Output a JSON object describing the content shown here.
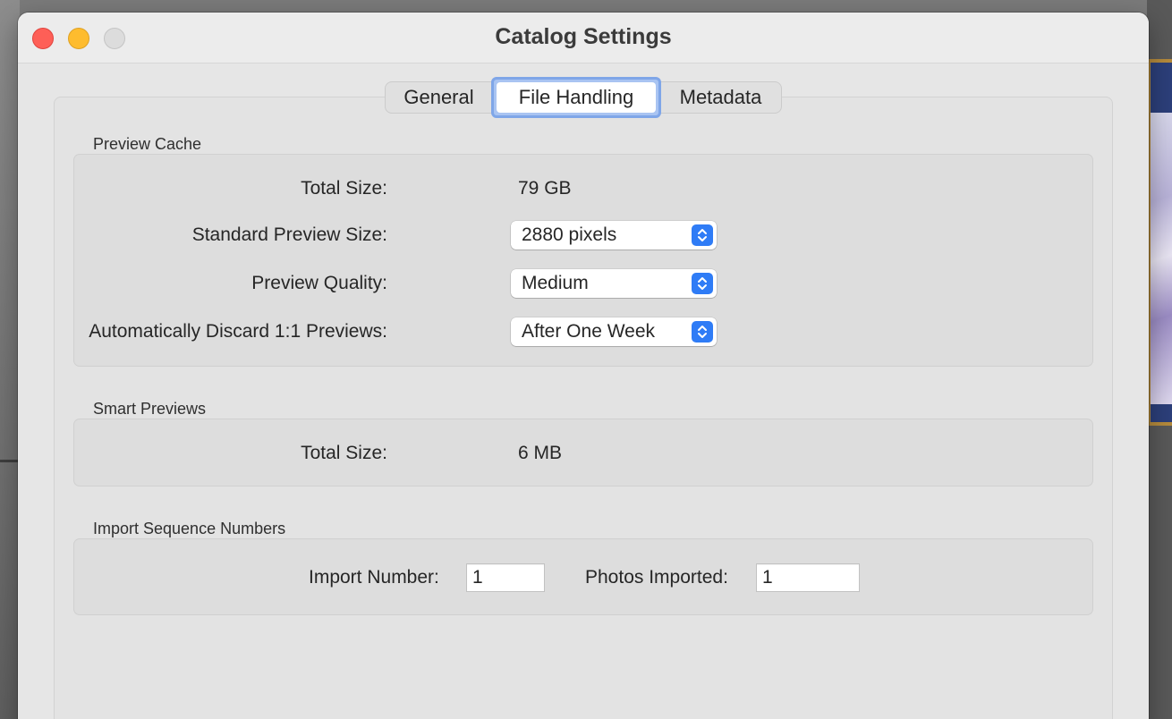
{
  "window": {
    "title": "Catalog Settings"
  },
  "tabs": [
    {
      "label": "General",
      "selected": false
    },
    {
      "label": "File Handling",
      "selected": true
    },
    {
      "label": "Metadata",
      "selected": false
    }
  ],
  "preview_cache": {
    "heading": "Preview Cache",
    "total_size_label": "Total Size:",
    "total_size_value": "79 GB",
    "standard_preview_size_label": "Standard Preview Size:",
    "standard_preview_size_value": "2880 pixels",
    "preview_quality_label": "Preview Quality:",
    "preview_quality_value": "Medium",
    "discard_label": "Automatically Discard 1:1 Previews:",
    "discard_value": "After One Week"
  },
  "smart_previews": {
    "heading": "Smart Previews",
    "total_size_label": "Total Size:",
    "total_size_value": "6 MB"
  },
  "import_sequence": {
    "heading": "Import Sequence Numbers",
    "import_number_label": "Import Number:",
    "import_number_value": "1",
    "photos_imported_label": "Photos Imported:",
    "photos_imported_value": "1"
  },
  "colors": {
    "accent": "#2f7cf6",
    "close": "#fe5f57",
    "minimize": "#febc2e",
    "zoom_inactive": "#dcdcdc"
  }
}
